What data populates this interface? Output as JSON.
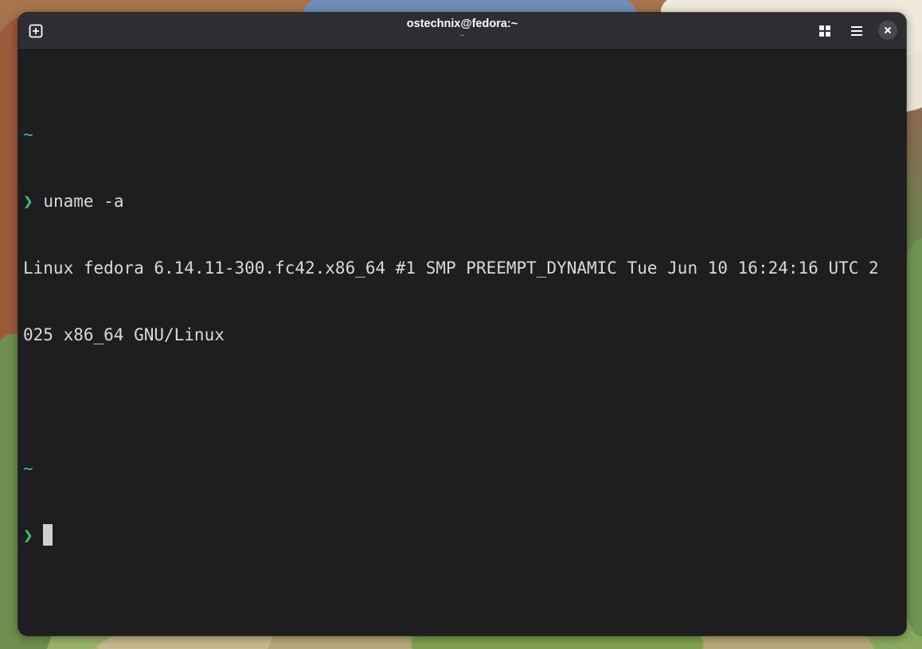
{
  "window": {
    "title": "ostechnix@fedora:~",
    "subtitle": "~"
  },
  "icons": {
    "new_tab": "new-tab-icon",
    "overview": "tab-overview-icon",
    "menu": "hamburger-menu-icon",
    "close": "close-icon"
  },
  "terminal": {
    "block1_dir": "~",
    "prompt_symbol": "❯",
    "command": "uname -a",
    "output_line1": "Linux fedora 6.14.11-300.fc42.x86_64 #1 SMP PREEMPT_DYNAMIC Tue Jun 10 16:24:16 UTC 2",
    "output_line2": "025 x86_64 GNU/Linux",
    "block2_dir": "~",
    "prompt_symbol_2": "❯"
  },
  "colors": {
    "terminal_bg": "#1e1e20",
    "headerbar_bg": "#2e2e32",
    "dir_color": "#3fb3b7",
    "prompt_color": "#36c47a",
    "text_color": "#d9d9d9"
  }
}
